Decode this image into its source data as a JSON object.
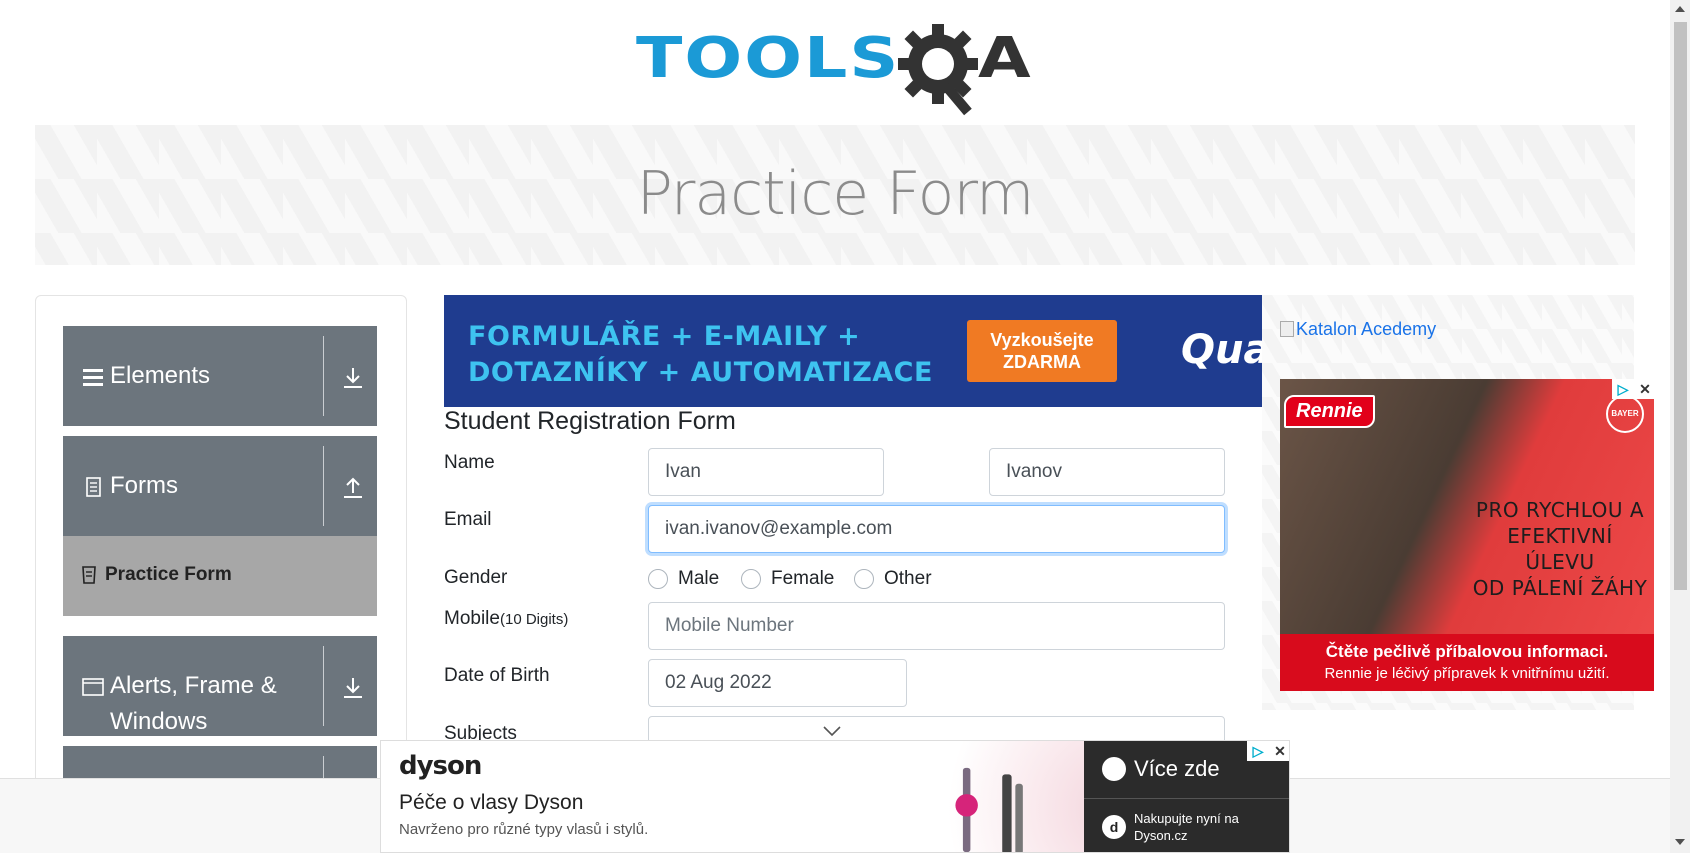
{
  "header": {
    "logo_text": "TOOLS",
    "logo_suffix": "A",
    "logo_alt": "ToolsQA"
  },
  "banner": {
    "title": "Practice Form"
  },
  "sidebar": {
    "groups": [
      {
        "label": "Elements",
        "icon": "hamburger-icon",
        "arrow": "download-icon"
      },
      {
        "label": "Forms",
        "icon": "document-icon",
        "arrow": "upload-icon"
      },
      {
        "label": "Alerts, Frame &",
        "label2": "Windows",
        "icon": "window-icon",
        "arrow": "download-icon"
      }
    ],
    "active_item": {
      "label": "Practice Form",
      "icon": "form-icon"
    }
  },
  "ad_top": {
    "line1": "FORMULÁŘE + E-MAILY +",
    "line2": "DOTAZNÍKY + AUTOMATIZACE",
    "cta_line1": "Vyzkoušejte",
    "cta_line2": "ZDARMA",
    "brand": "Qua"
  },
  "form": {
    "title": "Student Registration Form",
    "name_label": "Name",
    "first_name": "Ivan",
    "last_name": "Ivanov",
    "email_label": "Email",
    "email": "ivan.ivanov@example.com",
    "gender_label": "Gender",
    "gender_options": [
      "Male",
      "Female",
      "Other"
    ],
    "mobile_label": "Mobile",
    "mobile_hint": "(10 Digits)",
    "mobile_placeholder": "Mobile Number",
    "dob_label": "Date of Birth",
    "dob_value": "02 Aug 2022",
    "subjects_label": "Subjects"
  },
  "ad_right": {
    "katalon_alt": "Katalon Acedemy",
    "brand": "Rennie",
    "copy_line1": "PRO RYCHLOU A",
    "copy_line2": "EFEKTIVNÍ ÚLEVU",
    "copy_line3": "OD PÁLENÍ ŽÁHY",
    "foot1": "Čtěte pečlivě příbalovou informaci.",
    "foot2": "Rennie je léčivý přípravek k vnitřnímu užití.",
    "bayer": "BAYER"
  },
  "ad_bottom": {
    "logo": "dyson",
    "headline": "Péče o vlasy Dyson",
    "subline": "Navrženo pro různé typy vlasů i stylů.",
    "cta": "Více zde",
    "shop": "Nakupujte nyní na Dyson.cz"
  },
  "colors": {
    "accent": "#1b9ad6",
    "sidebar": "#6c757d",
    "active": "#a7a7a7"
  }
}
